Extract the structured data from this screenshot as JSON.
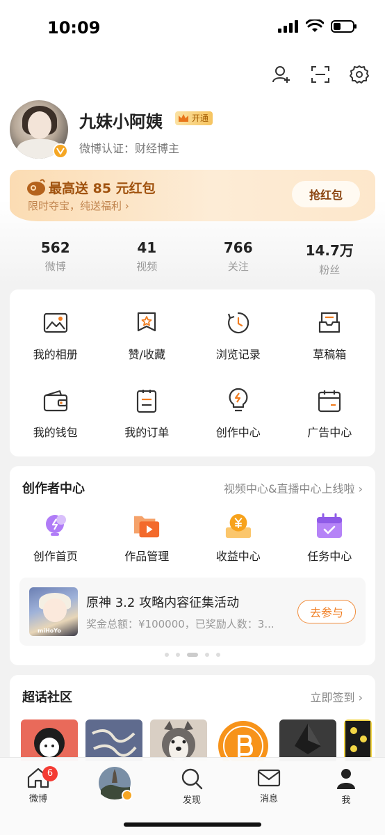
{
  "status_bar": {
    "time": "10:09"
  },
  "profile": {
    "name": "九妹小阿姨",
    "vip_label": "开通",
    "verification": "微博认证：财经博主"
  },
  "red_packet": {
    "title": "最高送 85 元红包",
    "subtitle": "限时夺宝，纯送福利 ›",
    "button": "抢红包"
  },
  "stats": [
    {
      "value": "562",
      "label": "微博"
    },
    {
      "value": "41",
      "label": "视频"
    },
    {
      "value": "766",
      "label": "关注"
    },
    {
      "value": "14.7万",
      "label": "粉丝"
    }
  ],
  "tools": [
    {
      "label": "我的相册",
      "icon": "photo-album-icon"
    },
    {
      "label": "赞/收藏",
      "icon": "bookmark-star-icon"
    },
    {
      "label": "浏览记录",
      "icon": "history-clock-icon"
    },
    {
      "label": "草稿箱",
      "icon": "drafts-tray-icon"
    },
    {
      "label": "我的钱包",
      "icon": "wallet-icon"
    },
    {
      "label": "我的订单",
      "icon": "order-list-icon"
    },
    {
      "label": "创作中心",
      "icon": "lightbulb-icon"
    },
    {
      "label": "广告中心",
      "icon": "calendar-ad-icon"
    }
  ],
  "creator": {
    "title": "创作者中心",
    "link": "视频中心&直播中心上线啦 ›",
    "items": [
      {
        "label": "创作首页",
        "icon": "creator-bulb-icon"
      },
      {
        "label": "作品管理",
        "icon": "video-folder-icon"
      },
      {
        "label": "收益中心",
        "icon": "yen-coin-icon"
      },
      {
        "label": "任务中心",
        "icon": "task-calendar-icon"
      }
    ],
    "activity": {
      "title": "原神 3.2 攻略内容征集活动",
      "subtitle": "奖金总额：¥100000，已奖励人数：3...",
      "button": "去参与",
      "thumb_brand": "miHoYo"
    }
  },
  "super_topic": {
    "title": "超话社区",
    "link": "立即签到 ›"
  },
  "bottom_nav": {
    "home": {
      "label": "微博",
      "badge": "6"
    },
    "discover": {
      "label": "发现"
    },
    "messages": {
      "label": "消息"
    },
    "me": {
      "label": "我"
    }
  },
  "colors": {
    "accent_orange": "#f07c1f",
    "badge_red": "#f43b33",
    "redpack_text": "#a0520e"
  }
}
